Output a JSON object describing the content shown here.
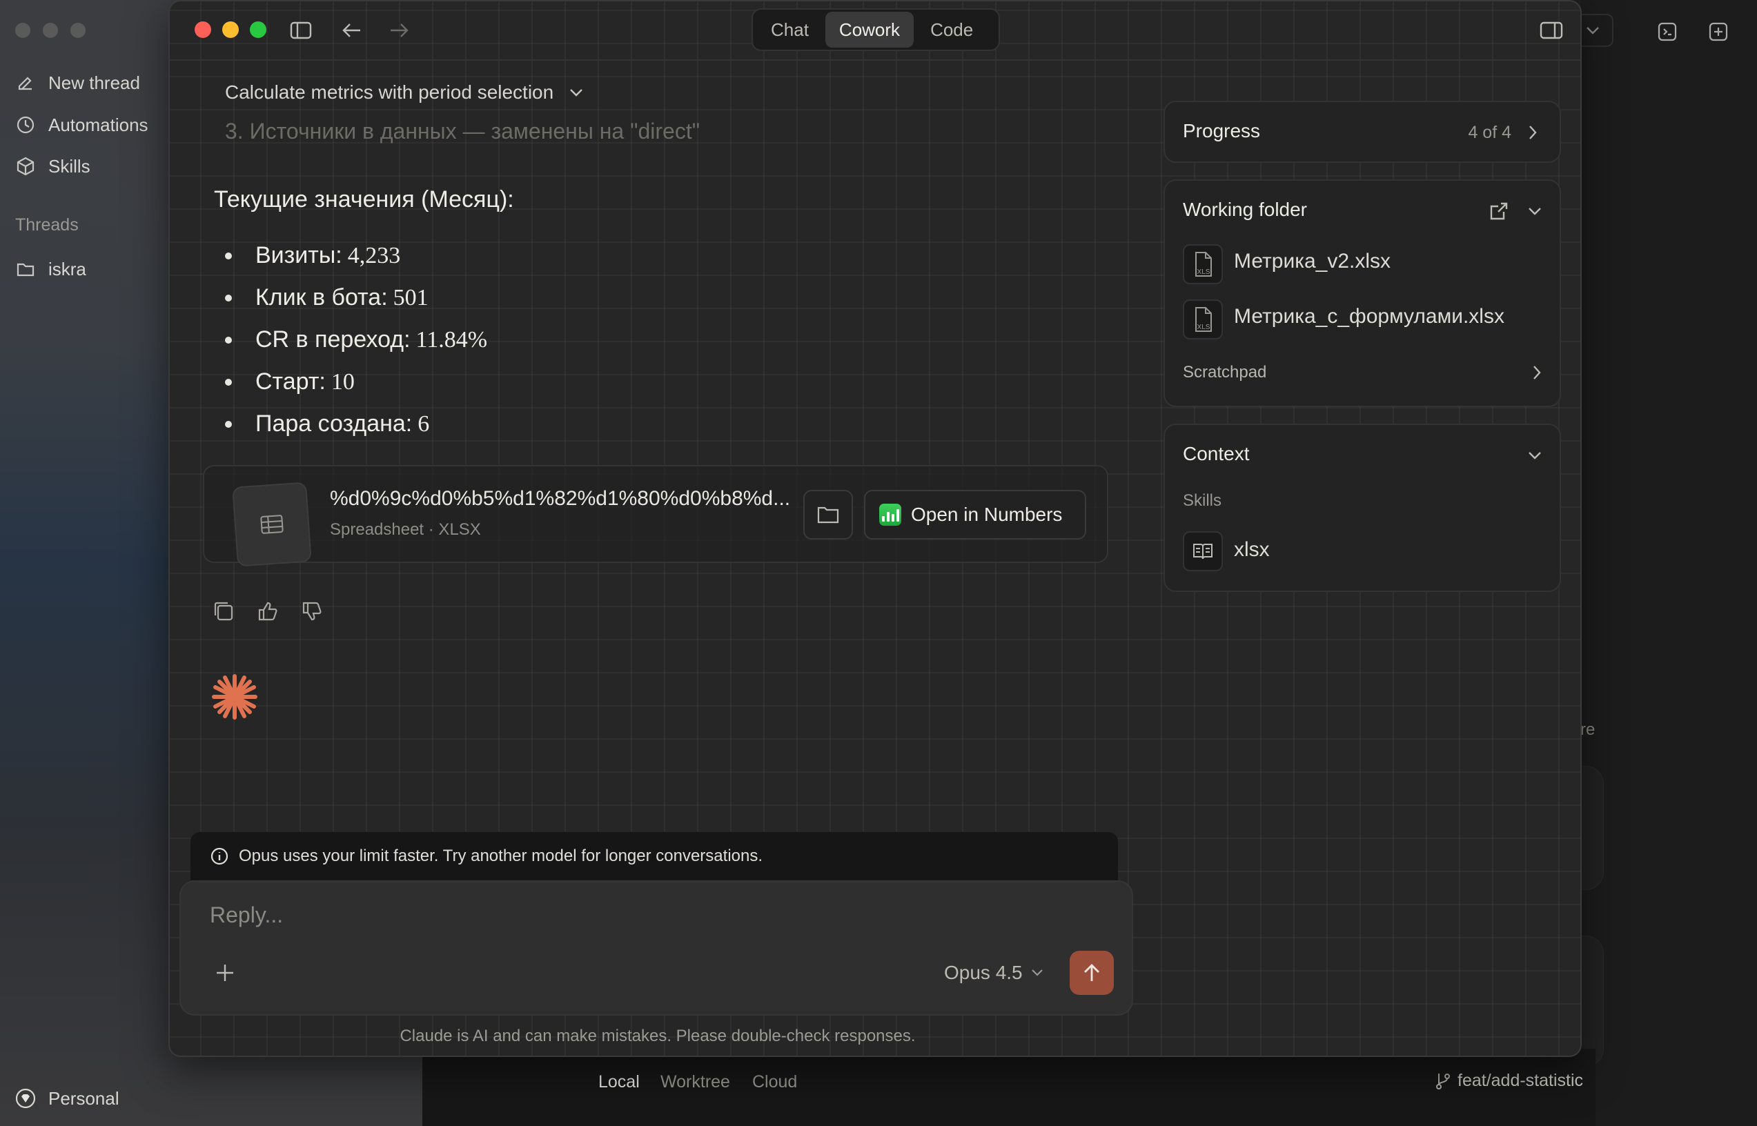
{
  "outer_sidebar": {
    "items": [
      {
        "label": "New thread",
        "icon": "edit-icon"
      },
      {
        "label": "Automations",
        "icon": "clock-icon"
      },
      {
        "label": "Skills",
        "icon": "cube-icon"
      }
    ],
    "threads_heading": "Threads",
    "threads": [
      {
        "label": "iskra",
        "icon": "folder-icon"
      }
    ],
    "account_label": "Personal"
  },
  "background_app": {
    "bottom_tabs": [
      "Local",
      "Worktree",
      "Cloud"
    ],
    "branch_label": "feat/add-statistic",
    "partial_text": "re"
  },
  "window": {
    "modes": [
      "Chat",
      "Cowork",
      "Code"
    ],
    "active_mode": "Cowork",
    "conversation_title": "Calculate metrics with period selection",
    "faded_line": "3.   Источники в данных — заменены на \"direct\"",
    "section_heading": "Текущие значения (Месяц):",
    "metrics": [
      {
        "label": "Визиты:",
        "value": "4,233"
      },
      {
        "label": "Клик в бота:",
        "value": "501"
      },
      {
        "label": "CR в переход:",
        "value": "11.84%"
      },
      {
        "label": "Старт:",
        "value": "10"
      },
      {
        "label": "Пара создана:",
        "value": "6"
      }
    ],
    "attachment": {
      "name": "%d0%9c%d0%b5%d1%82%d1%80%d0%b8%d...",
      "subtitle": "Spreadsheet · XLSX",
      "open_button": "Open in Numbers"
    },
    "limit_banner": "Opus uses your limit faster. Try another model for longer conversations.",
    "composer": {
      "placeholder": "Reply...",
      "model": "Opus 4.5"
    },
    "disclaimer": "Claude is AI and can make mistakes. Please double-check responses."
  },
  "right_panel": {
    "progress": {
      "title": "Progress",
      "count": "4 of 4"
    },
    "working_folder": {
      "title": "Working folder",
      "files": [
        "Метрика_v2.xlsx",
        "Метрика_с_формулами.xlsx"
      ],
      "file_icon_text": "XLS",
      "scratchpad": "Scratchpad"
    },
    "context": {
      "title": "Context",
      "skills_heading": "Skills",
      "skills": [
        "xlsx"
      ]
    }
  },
  "colors": {
    "accent_send": "#9a4e3a",
    "spark": "#e0724f",
    "traffic_red": "#fe5f57",
    "traffic_yellow": "#febc2e",
    "traffic_green": "#28c840"
  }
}
